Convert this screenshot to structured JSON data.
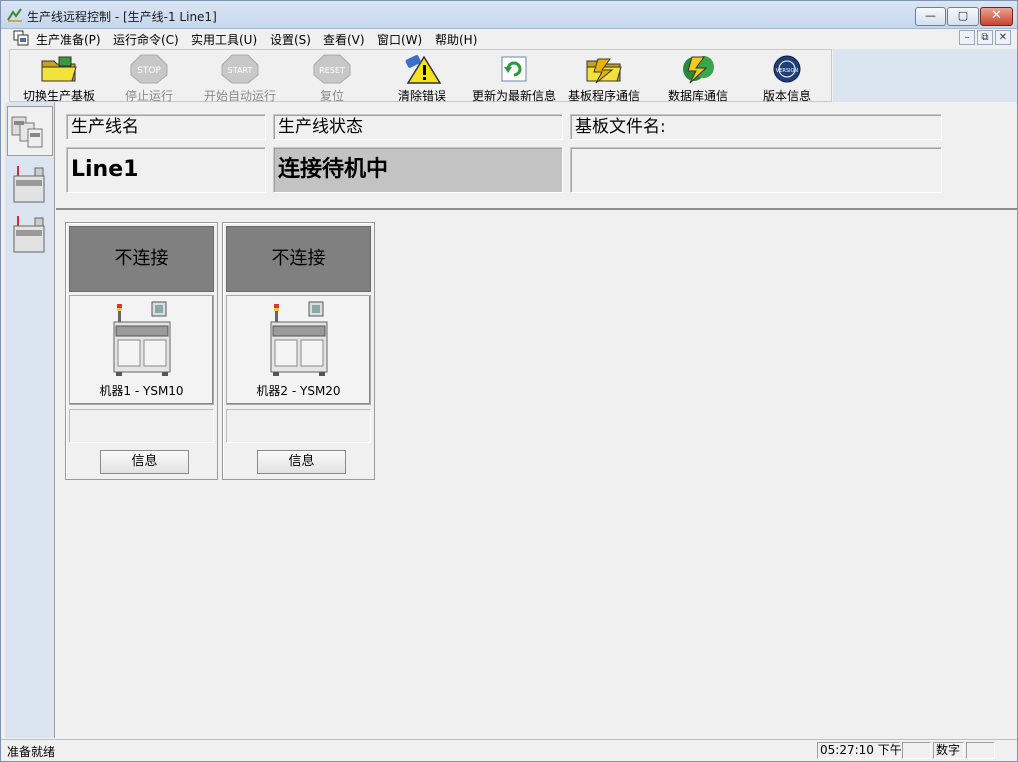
{
  "window": {
    "title": "生产线远程控制 - [生产线-1 Line1]",
    "min_glyph": "—",
    "max_glyph": "▢",
    "close_glyph": "✕"
  },
  "menu": {
    "items": [
      "生产准备(P)",
      "运行命令(C)",
      "实用工具(U)",
      "设置(S)",
      "查看(V)",
      "窗口(W)",
      "帮助(H)"
    ],
    "mdi_min": "–",
    "mdi_restore": "⧉",
    "mdi_close": "✕"
  },
  "toolbar": {
    "items": [
      {
        "label": "切换生产基板",
        "icon": "folder-icon",
        "enabled": true
      },
      {
        "label": "停止运行",
        "icon": "stop-icon",
        "enabled": false
      },
      {
        "label": "开始自动运行",
        "icon": "start-icon",
        "enabled": false
      },
      {
        "label": "复位",
        "icon": "reset-icon",
        "enabled": false
      },
      {
        "label": "清除错误",
        "icon": "clear-error-icon",
        "enabled": true
      },
      {
        "label": "更新为最新信息",
        "icon": "refresh-icon",
        "enabled": true
      },
      {
        "label": "基板程序通信",
        "icon": "board-comm-icon",
        "enabled": true
      },
      {
        "label": "数据库通信",
        "icon": "database-comm-icon",
        "enabled": true
      },
      {
        "label": "版本信息",
        "icon": "version-icon",
        "enabled": true
      }
    ],
    "stop_text": "STOP",
    "start_text": "START",
    "reset_text": "RESET",
    "version_text": "VERSION"
  },
  "line_info": {
    "name_header": "生产线名",
    "status_header": "生产线状态",
    "file_header": "基板文件名:",
    "name_value": "Line1",
    "status_value": "连接待机中",
    "file_value": ""
  },
  "machines": [
    {
      "status": "不连接",
      "name": "机器1 - YSM10",
      "info_button": "信息"
    },
    {
      "status": "不连接",
      "name": "机器2 - YSM20",
      "info_button": "信息"
    }
  ],
  "statusbar": {
    "message": "准备就绪",
    "time": "05:27:10 下午",
    "num_lock": "数字"
  },
  "colors": {
    "disconnected": "#808080",
    "status_bg": "#c3c3c3",
    "accent": "#dbe4f1"
  }
}
